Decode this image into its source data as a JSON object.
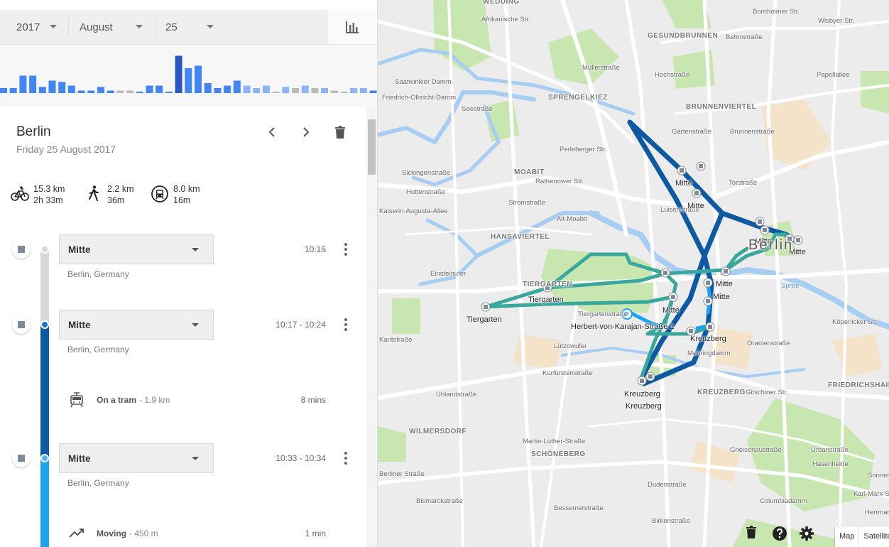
{
  "date": {
    "year": "2017",
    "month": "August",
    "day": "25"
  },
  "histogram": {
    "values": [
      4,
      4,
      14,
      14,
      5,
      10,
      9,
      6,
      2,
      2,
      5,
      2,
      2,
      2,
      1,
      6,
      6,
      1,
      30,
      20,
      22,
      8,
      4,
      6,
      10,
      6,
      4,
      6,
      1,
      5,
      4,
      6,
      4,
      4,
      2,
      1,
      4,
      4,
      2
    ],
    "colors": [
      "#4285f4",
      "#4285f4",
      "#4285f4",
      "#4285f4",
      "#4285f4",
      "#4285f4",
      "#4285f4",
      "#4285f4",
      "#4285f4",
      "#4285f4",
      "#4285f4",
      "#4285f4",
      "#bbbbbb",
      "#bbbbbb",
      "#4285f4",
      "#4285f4",
      "#4285f4",
      "#4285f4",
      "#2a56c6",
      "#4285f4",
      "#4285f4",
      "#4285f4",
      "#4285f4",
      "#4285f4",
      "#4285f4",
      "#8db4f7",
      "#8db4f7",
      "#8db4f7",
      "#bbbbbb",
      "#8db4f7",
      "#bbbbbb",
      "#8db4f7",
      "#bbbbbb",
      "#8db4f7",
      "#bbbbbb",
      "#bbbbbb",
      "#8db4f7",
      "#8db4f7",
      "#4285f4"
    ]
  },
  "header": {
    "title": "Berlin",
    "date": "Friday 25 August 2017"
  },
  "stats": [
    {
      "icon": "bicycle-icon",
      "distance": "15.3 km",
      "duration": "2h 33m"
    },
    {
      "icon": "walking-icon",
      "distance": "2.2 km",
      "duration": "36m"
    },
    {
      "icon": "transit-icon",
      "distance": "8.0 km",
      "duration": "16m"
    }
  ],
  "timeline": {
    "stops": [
      {
        "place": "Mitte",
        "location": "Berlin, Germany",
        "time": "10:16"
      },
      {
        "place": "Mitte",
        "location": "Berlin, Germany",
        "time": "10:17 - 10:24"
      },
      {
        "place": "Mitte",
        "location": "Berlin, Germany",
        "time": "10:33 - 10:34"
      }
    ],
    "moves": [
      {
        "mode": "On a tram",
        "distance": "- 1.9 km",
        "duration": "8 mins"
      },
      {
        "mode": "Moving",
        "distance": "- 450 m",
        "duration": "1 min"
      }
    ],
    "colors": {
      "grey": "#d5d5d5",
      "tram": "#0d5aa3",
      "moving": "#1da1f2"
    }
  },
  "map": {
    "districts": [
      "WEDDING",
      "GESUNDBRUNNEN",
      "SPRENGELKIEZ",
      "BRUNNENVIERTEL",
      "MOABIT",
      "HANSAVIERTEL",
      "TIERGARTEN",
      "KREUZBERG",
      "FRIEDRICHSHAIN",
      "WILMERSDORF",
      "SCHÖNEBERG"
    ],
    "streets": [
      "Seestraße",
      "Müllerstraße",
      "Perleberger Str.",
      "Torstraße",
      "Alt-Moabit",
      "Kantstraße",
      "Kurfürstenstraße",
      "Lützowufer",
      "Gitschiner Str.",
      "Oranienstraße",
      "Köpenicker Str.",
      "Spree",
      "Brunnenstraße",
      "Luisenstraße",
      "Behmstraße",
      "Bornholmer Str.",
      "Wisbyer Str.",
      "Berliner Straße",
      "Martin-Luther-Straße",
      "Uhlandstraße",
      "Dudenstraße",
      "Gneisenaustraße",
      "Urbanstraße",
      "Hasenheide",
      "Columbiadamm",
      "Sickingenstraße",
      "Huttenstraße",
      "Kaiserin-Augusta-Allee",
      "Einsteinufer",
      "Afrikanische Str.",
      "Saatwinkler Damm",
      "Friedrich-Olbricht-Damm",
      "Rathenower Str.",
      "Stromstraße",
      "Hochstraße",
      "Gartenstraße",
      "Tiergartenstraße",
      "Mehringdamm",
      "Bismarckstraße",
      "Papellallee",
      "Herrmannstraße",
      "Karl-Marx-Str.",
      "Sonnenallee",
      "Bessemerstraße",
      "Birkenstraße"
    ],
    "places": [
      {
        "name": "Mitte"
      },
      {
        "name": "Mitte"
      },
      {
        "name": "Mitte"
      },
      {
        "name": "Mitte"
      },
      {
        "name": "Mitte"
      },
      {
        "name": "Mitte"
      },
      {
        "name": "Mitte"
      },
      {
        "name": "Tiergarten"
      },
      {
        "name": "Tiergarten"
      },
      {
        "name": "Herbert-von-Karajan-Straße 1"
      },
      {
        "name": "Kreuzberg"
      },
      {
        "name": "Kreuzberg"
      },
      {
        "name": "Kreuzberg"
      }
    ],
    "city_label": "Berlin",
    "type_buttons": [
      "Map",
      "Satellite"
    ],
    "route_colors": {
      "tram": "#0d5aa3",
      "bike": "#3aa79c",
      "walk": "#1da1f2"
    }
  }
}
